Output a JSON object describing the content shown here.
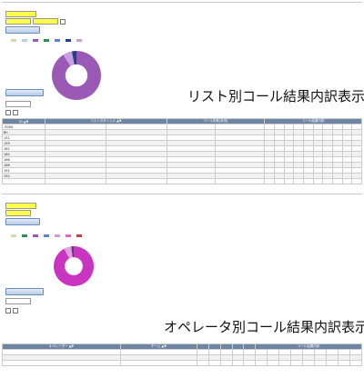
{
  "section1": {
    "heading": "リスト別コール結果内訳表示",
    "header_columns": [
      "ID ▲▼",
      "リストのタイトル ▲▼",
      "コール件数(状況)",
      "コール結果内訳"
    ],
    "legend": [
      {
        "color": "#d8d8a8"
      },
      {
        "color": "#a7d8d8"
      },
      {
        "color": "#9b59b6"
      },
      {
        "color": "#2e8b57"
      },
      {
        "color": "#5b7fd6"
      },
      {
        "color": "#1f3f8f"
      },
      {
        "color": "#c9a0dc"
      }
    ],
    "pie": [
      {
        "value": 91,
        "color": "#9b59b6"
      },
      {
        "value": 6,
        "color": "#c9a0dc"
      },
      {
        "value": 3,
        "color": "#1f3f8f"
      }
    ],
    "rows": [
      {
        "cols": [
          "-3000",
          "",
          "",
          "",
          "",
          "",
          "",
          "",
          "",
          "",
          "",
          "",
          "",
          "",
          ""
        ]
      },
      {
        "cols": [
          "Bh",
          "",
          "",
          "",
          "",
          "",
          "",
          "",
          "",
          "",
          "",
          "",
          "",
          "",
          ""
        ]
      },
      {
        "cols": [
          "151",
          "",
          "",
          "",
          "",
          "",
          "",
          "",
          "",
          "",
          "",
          "",
          "",
          "",
          ""
        ]
      },
      {
        "cols": [
          "159",
          "",
          "",
          "",
          "",
          "",
          "",
          "",
          "",
          "",
          "",
          "",
          "",
          "",
          ""
        ]
      },
      {
        "cols": [
          "162",
          "",
          "",
          "",
          "",
          "",
          "",
          "",
          "",
          "",
          "",
          "",
          "",
          "",
          ""
        ]
      },
      {
        "cols": [
          "164",
          "",
          "",
          "",
          "",
          "",
          "",
          "",
          "",
          "",
          "",
          "",
          "",
          "",
          ""
        ]
      },
      {
        "cols": [
          "166",
          "",
          "",
          "",
          "",
          "",
          "",
          "",
          "",
          "",
          "",
          "",
          "",
          "",
          ""
        ]
      },
      {
        "cols": [
          "168",
          "",
          "",
          "",
          "",
          "",
          "",
          "",
          "",
          "",
          "",
          "",
          "",
          "",
          ""
        ]
      },
      {
        "cols": [
          "191",
          "",
          "",
          "",
          "",
          "",
          "",
          "",
          "",
          "",
          "",
          "",
          "",
          "",
          ""
        ]
      },
      {
        "cols": [
          "192",
          "",
          "",
          "",
          "",
          "",
          "",
          "",
          "",
          "",
          "",
          "",
          "",
          "",
          ""
        ]
      },
      {
        "cols": [
          "",
          "",
          "",
          "",
          "",
          "",
          "",
          "",
          "",
          "",
          "",
          "",
          "",
          "",
          ""
        ]
      }
    ]
  },
  "section2": {
    "heading": "オペレータ別コール結果内訳表示",
    "header_columns": [
      "オペレーター ▲▼",
      "チーム ▲▼",
      "",
      "",
      "",
      "",
      "",
      "コール結果内訳"
    ],
    "legend": [
      {
        "color": "#d8d8a8"
      },
      {
        "color": "#2e8b57"
      },
      {
        "color": "#9b59b6"
      },
      {
        "color": "#5b7fd6"
      },
      {
        "color": "#c9a0dc"
      },
      {
        "color": "#e066c0"
      },
      {
        "color": "#b44"
      }
    ],
    "pie": [
      {
        "value": 92,
        "color": "#c935c0"
      },
      {
        "value": 6,
        "color": "#e0a0e0"
      },
      {
        "value": 2,
        "color": "#7a2a8a"
      }
    ],
    "rows": [
      {
        "cols": [
          "",
          "",
          "",
          "",
          "",
          "",
          "",
          "",
          "",
          "",
          "",
          "",
          "",
          "",
          "",
          ""
        ]
      },
      {
        "cols": [
          "",
          "",
          "",
          "",
          "",
          "",
          "",
          "",
          "",
          "",
          "",
          "",
          "",
          "",
          "",
          ""
        ]
      },
      {
        "cols": [
          "",
          "",
          "",
          "",
          "",
          "",
          "",
          "",
          "",
          "",
          "",
          "",
          "",
          "",
          "",
          ""
        ]
      }
    ]
  }
}
